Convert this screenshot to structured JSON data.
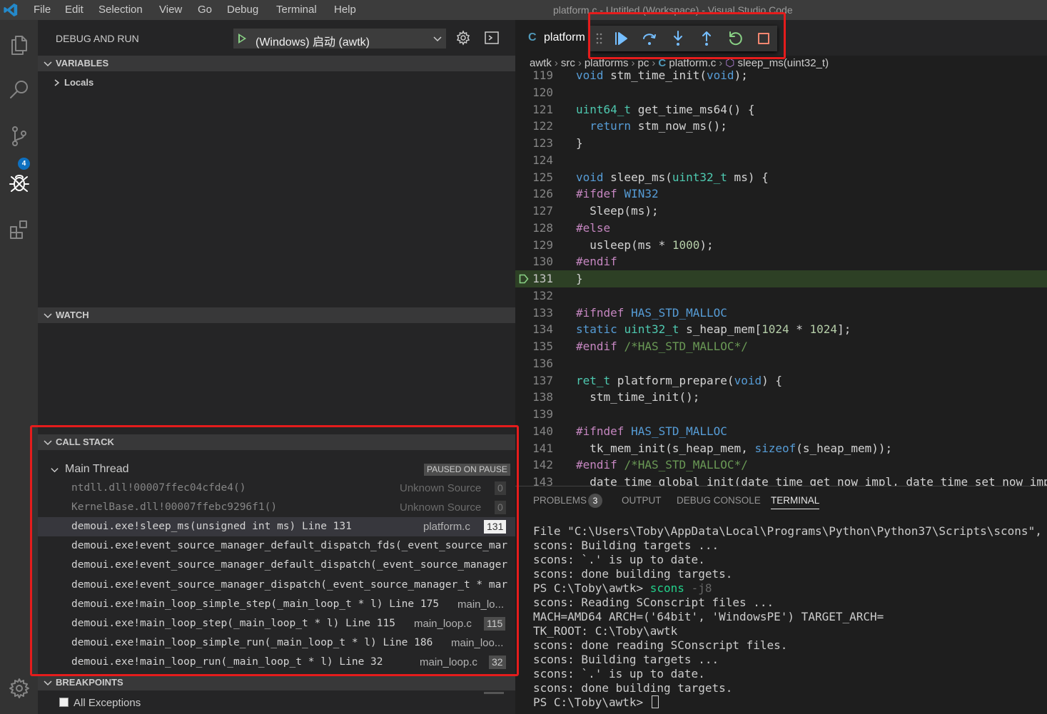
{
  "titlebar": {
    "menu": [
      "File",
      "Edit",
      "Selection",
      "View",
      "Go",
      "Debug",
      "Terminal",
      "Help"
    ],
    "window_title": "platform.c - Untitled (Workspace) - Visual Studio Code"
  },
  "activity_bar": {
    "items": [
      "files-icon",
      "search-icon",
      "source-control-icon",
      "debug-icon",
      "extensions-icon"
    ],
    "source_control_badge": "4",
    "settings": "gear-icon"
  },
  "debug_panel": {
    "title": "DEBUG AND RUN",
    "config_name": "(Windows) 启动 (awtk)",
    "variables_header": "VARIABLES",
    "locals_label": "Locals",
    "watch_header": "WATCH",
    "callstack_header": "CALL STACK",
    "thread_name": "Main Thread",
    "thread_status": "PAUSED ON PAUSE",
    "frames": [
      {
        "fn": "ntdll.dll!00007ffec04cfde4()",
        "src": "Unknown Source",
        "line": "0",
        "dim": true
      },
      {
        "fn": "KernelBase.dll!00007ffebc9296f1()",
        "src": "Unknown Source",
        "line": "0",
        "dim": true
      },
      {
        "fn": "demoui.exe!sleep_ms(unsigned int ms) Line 131",
        "src": "platform.c",
        "line": "131",
        "selected": true
      },
      {
        "fn": "demoui.exe!event_source_manager_default_dispatch_fds(_event_source_mar",
        "src": "",
        "line": ""
      },
      {
        "fn": "demoui.exe!event_source_manager_default_dispatch(_event_source_manager",
        "src": "",
        "line": ""
      },
      {
        "fn": "demoui.exe!event_source_manager_dispatch(_event_source_manager_t * mar",
        "src": "",
        "line": ""
      },
      {
        "fn": "demoui.exe!main_loop_simple_step(_main_loop_t * l) Line 175",
        "src": "main_lo...",
        "line": ""
      },
      {
        "fn": "demoui.exe!main_loop_step(_main_loop_t * l) Line 115",
        "src": "main_loop.c",
        "line": "115"
      },
      {
        "fn": "demoui.exe!main_loop_simple_run(_main_loop_t * l) Line 186",
        "src": "main_loo...",
        "line": ""
      },
      {
        "fn": "demoui.exe!main_loop_run(_main_loop_t * l) Line 32",
        "src": "main_loop.c",
        "line": "32"
      }
    ],
    "breakpoints_header": "BREAKPOINTS",
    "all_exceptions": "All Exceptions"
  },
  "editor": {
    "tab_icon": "C",
    "tab_name": "platform",
    "breadcrumb": [
      "awtk",
      "src",
      "platforms",
      "pc",
      "platform.c",
      "sleep_ms(uint32_t)"
    ],
    "toolbar": [
      "drag-grip",
      "continue-icon",
      "step-over-icon",
      "step-into-icon",
      "step-out-icon",
      "restart-icon",
      "stop-icon"
    ],
    "current_line": "131",
    "lines": [
      {
        "n": "119",
        "t": "void stm_time_init(void);"
      },
      {
        "n": "120",
        "t": ""
      },
      {
        "n": "121",
        "t": "uint64_t get_time_ms64() {"
      },
      {
        "n": "122",
        "t": "  return stm_now_ms();"
      },
      {
        "n": "123",
        "t": "}"
      },
      {
        "n": "124",
        "t": ""
      },
      {
        "n": "125",
        "t": "void sleep_ms(uint32_t ms) {"
      },
      {
        "n": "126",
        "t": "#ifdef WIN32"
      },
      {
        "n": "127",
        "t": "  Sleep(ms);"
      },
      {
        "n": "128",
        "t": "#else"
      },
      {
        "n": "129",
        "t": "  usleep(ms * 1000);"
      },
      {
        "n": "130",
        "t": "#endif"
      },
      {
        "n": "131",
        "t": "}"
      },
      {
        "n": "132",
        "t": ""
      },
      {
        "n": "133",
        "t": "#ifndef HAS_STD_MALLOC"
      },
      {
        "n": "134",
        "t": "static uint32_t s_heap_mem[1024 * 1024];"
      },
      {
        "n": "135",
        "t": "#endif /*HAS_STD_MALLOC*/"
      },
      {
        "n": "136",
        "t": ""
      },
      {
        "n": "137",
        "t": "ret_t platform_prepare(void) {"
      },
      {
        "n": "138",
        "t": "  stm_time_init();"
      },
      {
        "n": "139",
        "t": ""
      },
      {
        "n": "140",
        "t": "#ifndef HAS_STD_MALLOC"
      },
      {
        "n": "141",
        "t": "  tk_mem_init(s_heap_mem, sizeof(s_heap_mem));"
      },
      {
        "n": "142",
        "t": "#endif /*HAS_STD_MALLOC*/"
      },
      {
        "n": "143",
        "t": "  date_time_global_init(date_time_get_now_impl, date_time_set_now_imp"
      }
    ]
  },
  "panel": {
    "tabs": [
      "PROBLEMS",
      "OUTPUT",
      "DEBUG CONSOLE",
      "TERMINAL"
    ],
    "problems_count": "3",
    "active_tab": "TERMINAL",
    "terminal_lines": [
      "File \"C:\\Users\\Toby\\AppData\\Local\\Programs\\Python\\Python37\\Scripts\\scons\", line",
      "scons: Building targets ...",
      "scons: `.' is up to date.",
      "scons: done building targets.",
      "PS C:\\Toby\\awtk> ",
      "scons: Reading SConscript files ...",
      "MACH=AMD64 ARCH=('64bit', 'WindowsPE') TARGET_ARCH=",
      "TK_ROOT: C:\\Toby\\awtk",
      "scons: done reading SConscript files.",
      "scons: Building targets ...",
      "scons: `.' is up to date.",
      "scons: done building targets.",
      "PS C:\\Toby\\awtk> "
    ],
    "prompt_cmd": "scons",
    "prompt_arg": " -j8"
  }
}
